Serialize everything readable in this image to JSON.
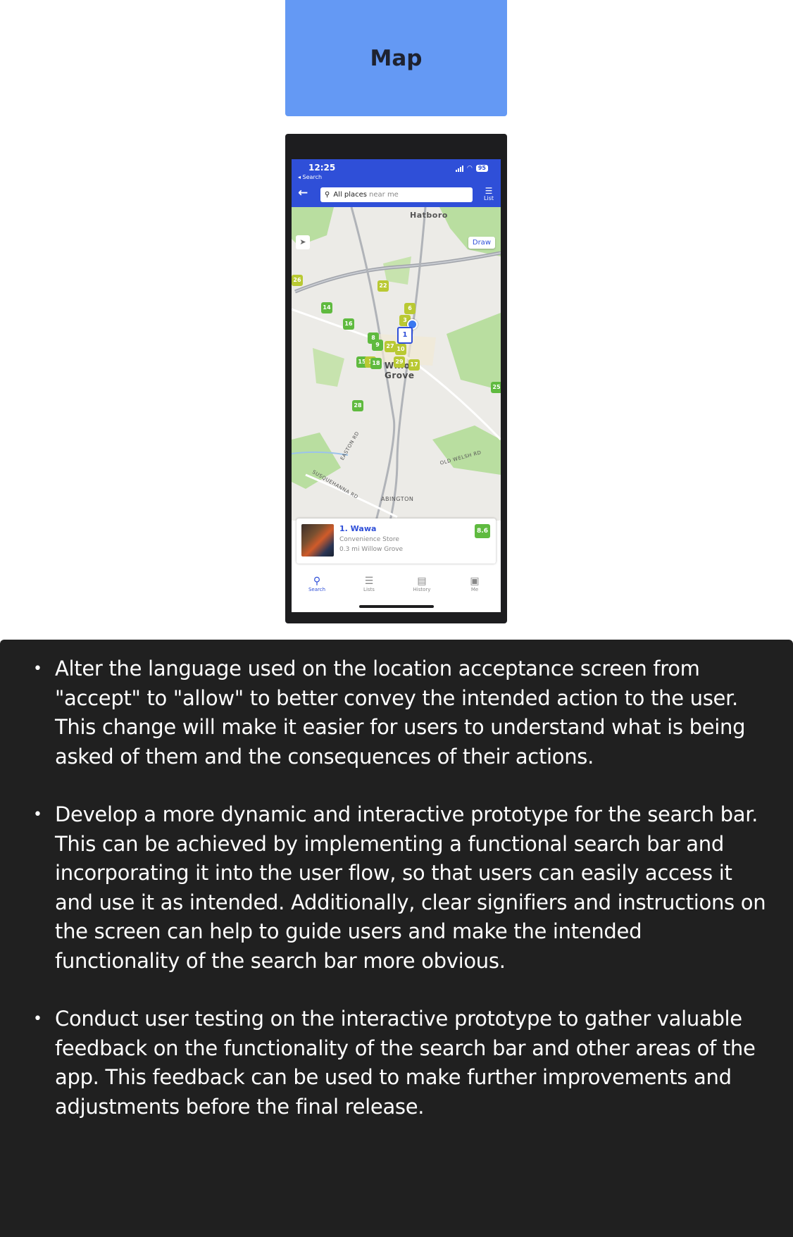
{
  "header": {
    "title": "Map"
  },
  "phone": {
    "status": {
      "time": "12:25",
      "back_label": "◂ Search",
      "battery": "95"
    },
    "search": {
      "label": "All places",
      "placeholder": "near me"
    },
    "list_label": "List",
    "map": {
      "labels": [
        "Hatboro",
        "Willow Grove",
        "ABINGTON",
        "OLD WELSH RD",
        "SUSQUEHANNA RD",
        "EASTON RD"
      ],
      "draw_label": "Draw",
      "pins": [
        "26",
        "22",
        "14",
        "16",
        "6",
        "3",
        "1",
        "8",
        "9",
        "27",
        "10",
        "15",
        "1",
        "18",
        "29",
        "17",
        "28",
        "25"
      ]
    },
    "result": {
      "title": "1. Wawa",
      "category": "Convenience Store",
      "meta": "0.3 mi  Willow Grove",
      "score": "8.6"
    },
    "tabs": [
      {
        "label": "Search",
        "icon": "search-icon"
      },
      {
        "label": "Lists",
        "icon": "list-icon"
      },
      {
        "label": "History",
        "icon": "history-icon"
      },
      {
        "label": "Me",
        "icon": "profile-icon"
      }
    ]
  },
  "notes": [
    "Alter the language used on the location acceptance screen from \"accept\" to \"allow\" to better convey the intended action to the user. This change will make it easier for users to understand what is being asked of them and the consequences of their actions.",
    "Develop a more dynamic and interactive prototype for the search bar. This can be achieved by implementing a functional search bar and incorporating it into the user flow, so that users can easily access it and use it as intended. Additionally, clear signifiers and instructions on the screen can help to guide users and make the intended functionality of the search bar more obvious.",
    "Conduct user testing on the interactive prototype to gather valuable feedback on the functionality of the search bar and other areas of the app. This feedback can be used to make further improvements and adjustments before the final release."
  ]
}
